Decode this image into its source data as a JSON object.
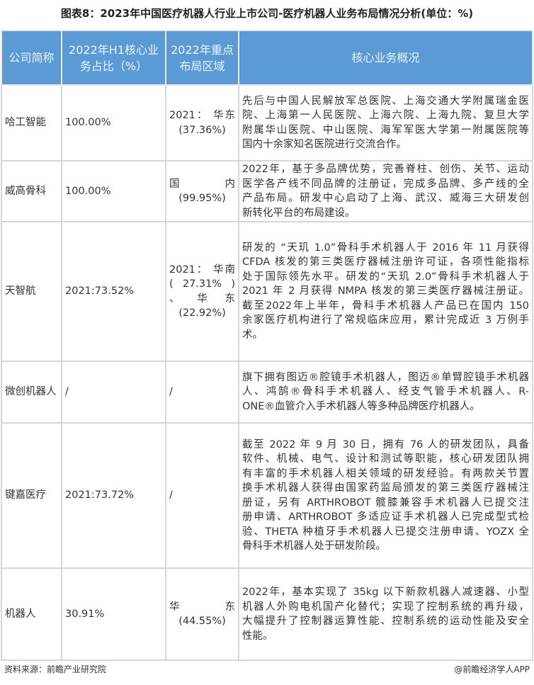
{
  "title": "图表8：2023年中国医疗机器人行业上市公司-医疗机器人业务布局情况分析(单位：%)",
  "headers": [
    "公司简称",
    "2022年H1核心业务占比（%）",
    "2022年重点布局区域",
    "核心业务概况"
  ],
  "rows": [
    {
      "company": "哈工智能",
      "share": "100.00%",
      "region": [
        "2021： 华东",
        "(37.36%)"
      ],
      "desc": [
        "先后与中国人民解放军总医院、上海交通大学附属瑞金医",
        "院、上海第一人民医院、上海六院、上海九院、复旦大学",
        "附属华山医院、中山医院、海军军医大学第一附属医院等",
        "国内十余家知名医院进行交流合作。"
      ]
    },
    {
      "company": "威高骨科",
      "share": "100.00%",
      "region": [
        "国 内",
        "(99.95%)"
      ],
      "desc": [
        "2022年，基于多品牌优势，完善脊柱、创伤、关节、运动",
        "医学各产线不同品牌的注册证，完成多品牌、多产线的全",
        "产品布局。研发中心启动了上海、武汉、威海三大研发创",
        "新转化平台的布局建设。"
      ]
    },
    {
      "company": "天智航",
      "share": "2021:73.52%",
      "region": [
        "2021： 华南",
        "( 27.31% )",
        "、 华 东",
        "(22.92%)"
      ],
      "desc": [
        "研发的 “天玑 1.0”骨科手术机器人于 2016 年 11 月获得",
        "CFDA 核发的第三类医疗器械注册许可证，各项性能指标",
        "处于国际领先水平。研发的“天玑 2.0”骨科手术机器人于",
        "2021 年 2 月获得 NMPA 核发的第三类医疗器械注册证。",
        "截至2022年上半年，骨科手术机器人产品已在国内 150",
        "余家医疗机构进行了常规临床应用，累计完成近 3 万例手",
        "术。"
      ]
    },
    {
      "company": "微创机器人",
      "share": "/",
      "region": [
        "/"
      ],
      "desc": [
        "旗下拥有图迈®腔镜手术机器人，图迈®单臂腔镜手术机器",
        "人、鸿鹄®骨科手术机器人、经支气管手术机器人、R-",
        "ONE®血管介入手术机器人等多种品牌医疗机器人。"
      ]
    },
    {
      "company": "键嘉医疗",
      "share": "2021:73.72%",
      "region": [
        "/"
      ],
      "desc": [
        "截至 2022 年 9 月 30 日，拥有 76 人的研发团队，具备",
        "软件、机械、电气、设计和测试等职能，核心研发团队拥",
        "有丰富的手术机器人相关领域的研发经验。有两款关节置",
        "换手术机器人获得由国家药监局颁发的第三类医疗器械注",
        "册证，另有 ARTHROBOT 髋膝兼容手术机器人已提交注",
        "册申请、ARTHROBOT 多适应证手术机器人已完成型式检",
        "验、THETA 种植牙手术机器人已提交注册申请、YOZX 全",
        "骨科手术机器人处于研发阶段。"
      ]
    },
    {
      "company": "机器人",
      "share": "30.91%",
      "region": [
        "华 东",
        "(44.55%)"
      ],
      "desc": [
        "2022年，基本实现了 35kg 以下新款机器人减速器、小型",
        "机器人外购电机国产化替代；实现了控制系统的再升级，",
        "大幅提升了控制器运算性能、控制系统的运动性能及安全",
        "性能。"
      ]
    }
  ],
  "footer": {
    "source": "资料来源：前瞻产业研究院",
    "brand": "@前瞻经济学人APP"
  }
}
